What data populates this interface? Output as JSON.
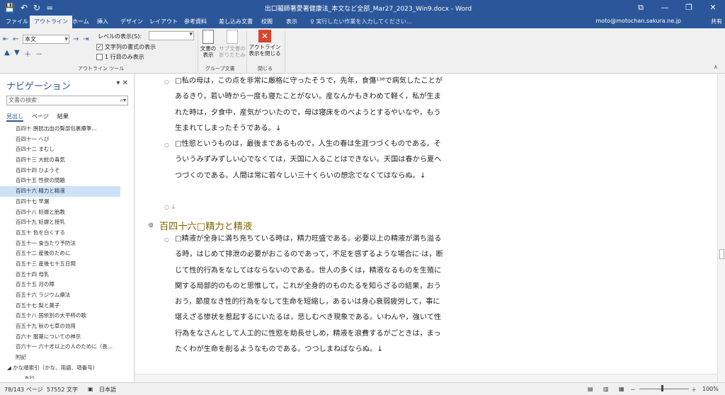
{
  "window": {
    "title": "出口鬮師著愛著健康法_本文など全部_Mar27_2023_Win9.docx - Word",
    "qat_save": "💾",
    "qat_undo": "↶",
    "qat_redo": "↻",
    "qat_more": "=",
    "btn_ribbon_display": "⧉",
    "btn_minimize": "—",
    "btn_maximize": "❐",
    "btn_close": "✕"
  },
  "tabs": [
    {
      "label": "ファイル"
    },
    {
      "label": "アウトライン"
    },
    {
      "label": "ホーム"
    },
    {
      "label": "挿入"
    },
    {
      "label": "デザイン"
    },
    {
      "label": "レイアウト"
    },
    {
      "label": "参考資料"
    },
    {
      "label": "差し込み文書"
    },
    {
      "label": "校閲"
    },
    {
      "label": "表示"
    }
  ],
  "tellme": "♀ 実行したい作業を入力してください...",
  "account": "moto@motochan.sakura.ne.jp",
  "share": "共有",
  "ribbon": {
    "style_value": "本文",
    "level_label": "レベルの表示(S):",
    "show_text_format": "文字列の書式の表示",
    "show_first_line": "1 行目のみ表示",
    "outline_tools": "アウトライン ツール",
    "show_document": "文書の\n表示",
    "collapse_subdocs": "サブ文書の\n折りたたみ",
    "master_document": "グループ文書",
    "close_outline": "アウトライン\n表示を閉じる",
    "close_group": "閉じる"
  },
  "nav": {
    "title": "ナビゲーション",
    "search_placeholder": "文書の検索",
    "tabs": [
      "見出し",
      "ページ",
      "結果"
    ],
    "items": [
      {
        "label": "百四十 膀胱出血の臀部包裹療筆..."
      },
      {
        "label": "百四十一 へび"
      },
      {
        "label": "百四十二 まむし"
      },
      {
        "label": "百四十三 大蛇の毒気"
      },
      {
        "label": "百四十四 ひようそ"
      },
      {
        "label": "百四十五 性欲の問題"
      },
      {
        "label": "百四十六 精力と精液",
        "selected": true
      },
      {
        "label": "百四十七 早漏"
      },
      {
        "label": "百四十八 妊娠と胎教"
      },
      {
        "label": "百四十九 妊娠と授乳"
      },
      {
        "label": "百五十 色を白くする"
      },
      {
        "label": "百五十一 食当たり予防法"
      },
      {
        "label": "百五十二 産後のために"
      },
      {
        "label": "百五十三 産後七十五日間"
      },
      {
        "label": "百五十四 母乳"
      },
      {
        "label": "百五十五 月の障"
      },
      {
        "label": "百五十六 ラジウム療法"
      },
      {
        "label": "百五十七 梨と菓子"
      },
      {
        "label": "百五十八 国依別の大平柿の歌"
      },
      {
        "label": "百五十九 秋の七草の効用"
      },
      {
        "label": "百六十 服薬についての神示"
      },
      {
        "label": "百六十一 六十才以上の人のために（長..."
      },
      {
        "label": "附記"
      },
      {
        "label": "◢ かな順索引（かな、用語、項番号）"
      },
      {
        "label": "あ行"
      }
    ]
  },
  "doc": {
    "para1": "□私の母は，この点を非常に厳格に守ったそうで，先年，食傷¹³⁸で病気したことがあるきり，若い時から一度も寝たことがない。産なんかもきわめて軽く，私が生まれた時は，夕食中，産気がついたので，母は寝床をのべようとするやいなや，もう生まれてしまったそうである。↓",
    "para2": "□性慾というものは，最後まであるもので，人生の春は生涯つづくものである。そういうみずみずしい心でなくては，天国に入ることはできない。天国は春から夏へつづくのである。人間は常に若々しい三十くらいの想念でなくてはならぬ。↓",
    "empty_mark": "○ ↓",
    "heading": "百四十六□精力と精液",
    "para3": "□精液が全身に満ち充ちている時は，精力旺盛である。必要以上の精液が満ち溢るる時，はじめて排泄の必要がおこるのであって，不足を感ずるような場合に·は，断じて性的行為をなしてはならないのである。世人の多くは，精液なるものを生殖に関する局部的のものと思惟して，これが全身的のものたるを知らざるの結果，おうおう，節度なき性的行為をなして生命を短縮し，あるいは身心衰弱疲労して，事に堪えざる惨状を惹起するにいたるは，悲しむべき現象である。いわんや，強いて性行為をなさんとして人工的に性慾を助長せしめ，精液を浪費するがごときは，まったくわが生命を削るようなものである。つつしまねばならぬ。↓"
  },
  "status": {
    "page": "78/143 ページ",
    "words": "57552 文字",
    "language": "日本語",
    "zoom": "100%"
  }
}
